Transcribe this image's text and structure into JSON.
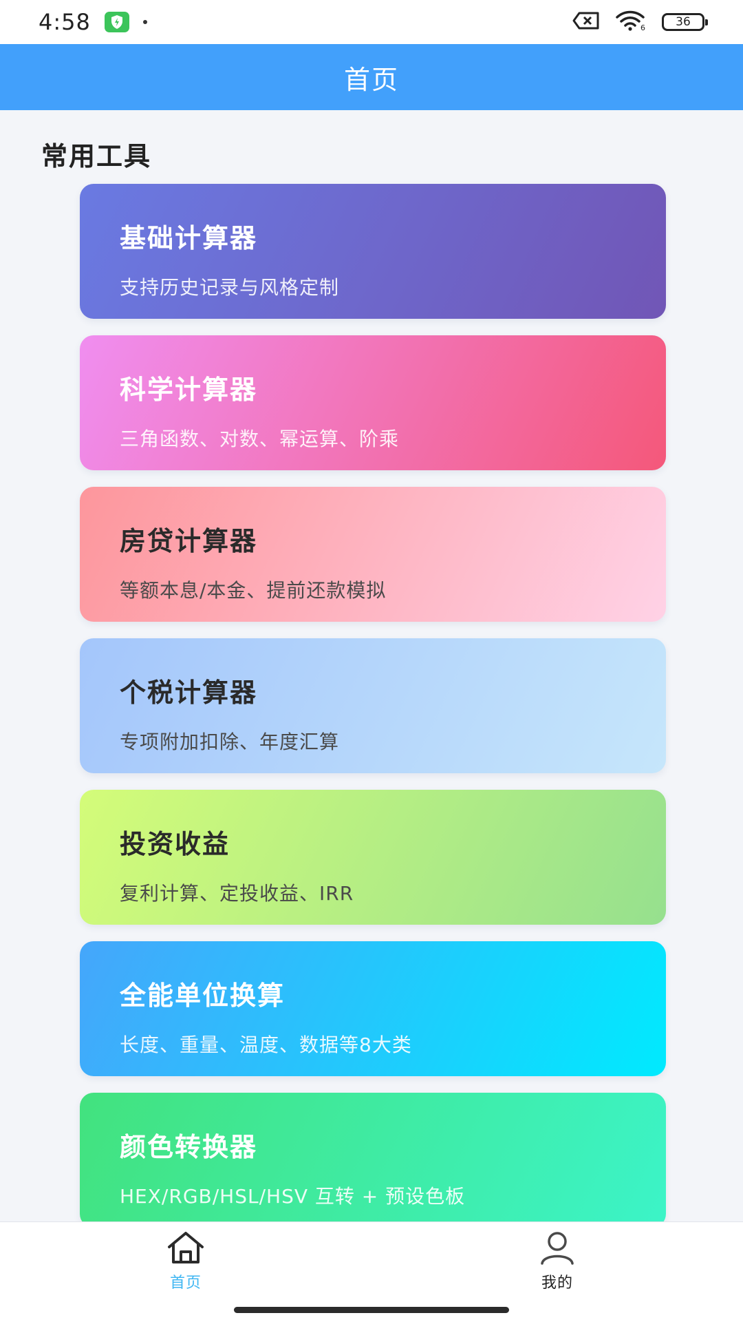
{
  "status_bar": {
    "time": "4:58",
    "battery": "36",
    "icons": [
      "shield-icon",
      "dot-icon",
      "sim-x-icon",
      "wifi-icon",
      "battery-icon"
    ]
  },
  "header": {
    "title": "首页"
  },
  "section": {
    "title": "常用工具"
  },
  "tools": [
    {
      "title": "基础计算器",
      "desc": "支持历史记录与风格定制",
      "gradient": [
        "#6a7ae2",
        "#7156b6"
      ]
    },
    {
      "title": "科学计算器",
      "desc": "三角函数、对数、幂运算、阶乘",
      "gradient": [
        "#f08ef0",
        "#f4587a"
      ]
    },
    {
      "title": "房贷计算器",
      "desc": "等额本息/本金、提前还款模拟",
      "gradient": [
        "#fd969c",
        "#ffd2e6"
      ]
    },
    {
      "title": "个税计算器",
      "desc": "专项附加扣除、年度汇算",
      "gradient": [
        "#a4c6fb",
        "#c6e6fb"
      ]
    },
    {
      "title": "投资收益",
      "desc": "复利计算、定投收益、IRR",
      "gradient": [
        "#d4fc79",
        "#96e08e"
      ]
    },
    {
      "title": "全能单位换算",
      "desc": "长度、重量、温度、数据等8大类",
      "gradient": [
        "#45a6fb",
        "#00eafe"
      ]
    },
    {
      "title": "颜色转换器",
      "desc": "HEX/RGB/HSL/HSV 互转 + 预设色板",
      "gradient": [
        "#42e27e",
        "#3cf4c8"
      ]
    }
  ],
  "bottom_nav": {
    "home_label": "首页",
    "mine_label": "我的",
    "active_color": "#3fb6f2",
    "icons": [
      "home-icon",
      "user-icon"
    ]
  },
  "colors": {
    "header_bg": "#42a0fb",
    "page_bg": "#f3f5f9"
  }
}
